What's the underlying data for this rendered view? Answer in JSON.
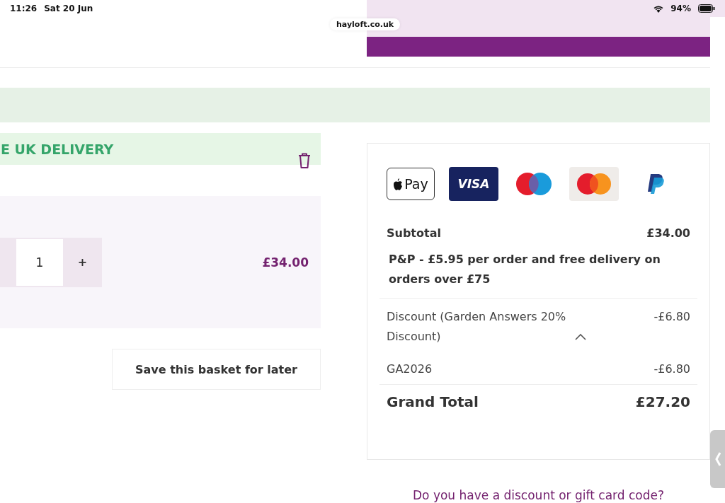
{
  "status_bar": {
    "time": "11:26",
    "date": "Sat 20 Jun",
    "battery": "94%"
  },
  "url": "hayloft.co.uk",
  "delivery_banner": {
    "text": "E UK DELIVERY"
  },
  "basket_item": {
    "quantity": "1",
    "increase": "+",
    "price": "£34.00"
  },
  "save_button": "Save this basket for later",
  "payment_methods": [
    {
      "kind": "applepay",
      "label": "Pay"
    },
    {
      "kind": "visa",
      "label": "VISA"
    },
    {
      "kind": "maestro"
    },
    {
      "kind": "mastercard"
    },
    {
      "kind": "paypal"
    }
  ],
  "summary": {
    "subtotal": {
      "label": "Subtotal",
      "value": "£34.00"
    },
    "shipping_note": "P&P - £5.95 per order and free delivery on orders over £75",
    "discount": {
      "label": "Discount (Garden Answers 20% Discount)",
      "value": "-£6.80",
      "expanded": true
    },
    "codes": [
      {
        "code": "GA2026",
        "value": "-£6.80"
      }
    ],
    "grand_total": {
      "label": "Grand Total",
      "value": "£27.20"
    }
  },
  "discount_link": "Do you have a discount or gift card code?"
}
